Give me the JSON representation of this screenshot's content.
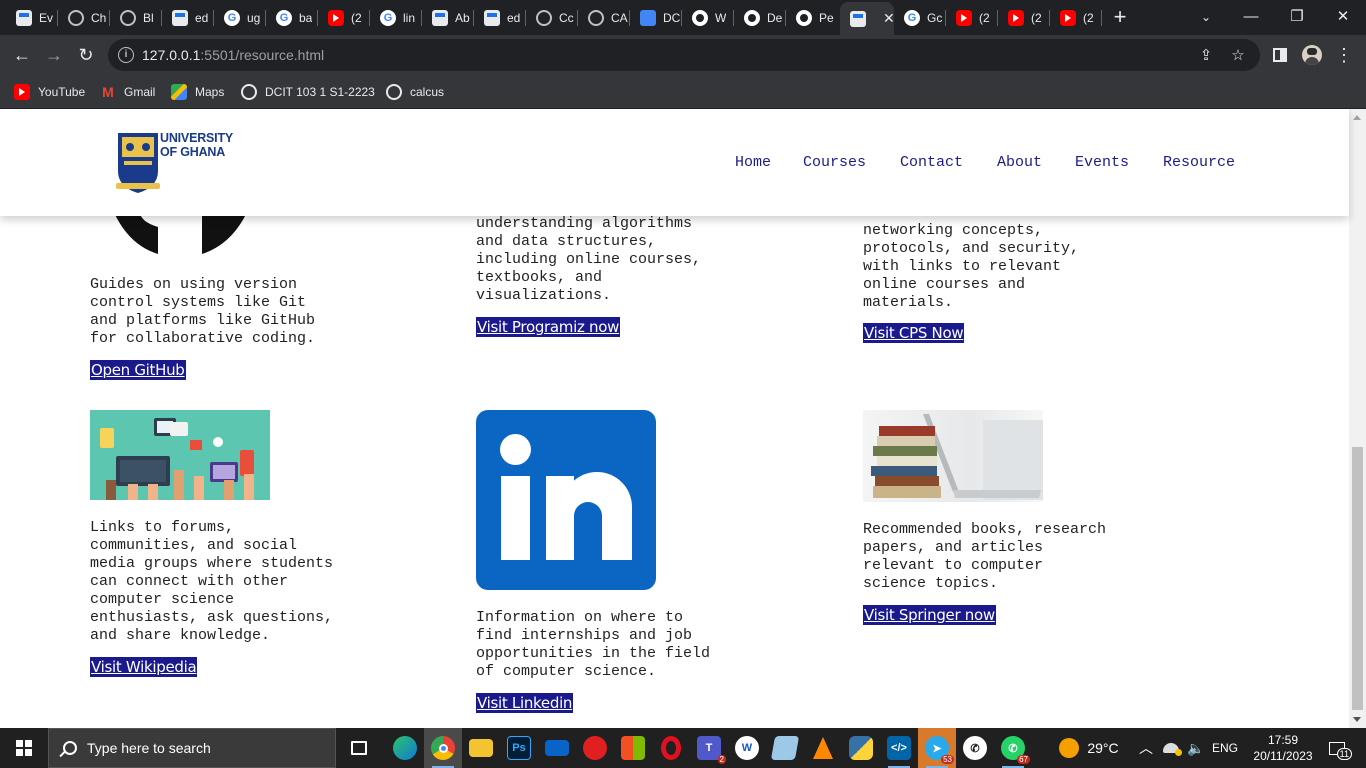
{
  "browser": {
    "tabs": [
      {
        "title": "Ev",
        "icon": "doc"
      },
      {
        "title": "Ch",
        "icon": "chatgpt"
      },
      {
        "title": "Bl",
        "icon": "globe"
      },
      {
        "title": "ed",
        "icon": "doc"
      },
      {
        "title": "ug",
        "icon": "google"
      },
      {
        "title": "ba",
        "icon": "google"
      },
      {
        "title": "(2",
        "icon": "youtube"
      },
      {
        "title": "lin",
        "icon": "google"
      },
      {
        "title": "Ab",
        "icon": "doc"
      },
      {
        "title": "ed",
        "icon": "doc"
      },
      {
        "title": "Cc",
        "icon": "globe"
      },
      {
        "title": "CA",
        "icon": "globe"
      },
      {
        "title": "DC",
        "icon": "gdoc"
      },
      {
        "title": "W",
        "icon": "github"
      },
      {
        "title": "De",
        "icon": "github"
      },
      {
        "title": "Pe",
        "icon": "github"
      },
      {
        "title": "",
        "icon": "doc",
        "active": true
      },
      {
        "title": "Gc",
        "icon": "google"
      },
      {
        "title": "(2",
        "icon": "youtube"
      },
      {
        "title": "(2",
        "icon": "youtube"
      },
      {
        "title": "(2",
        "icon": "youtube"
      }
    ],
    "new_tab_symbol": "+",
    "close_symbol": "✕",
    "url_host": "127.0.0.1",
    "url_rest": ":5501/resource.html",
    "bookmarks": [
      {
        "label": "YouTube",
        "icon": "youtube"
      },
      {
        "label": "Gmail",
        "icon": "gmail"
      },
      {
        "label": "Maps",
        "icon": "maps"
      },
      {
        "label": "DCIT 103 1 S1-2223",
        "icon": "globe"
      },
      {
        "label": "calcus",
        "icon": "globe"
      }
    ]
  },
  "site": {
    "logo_line1": "UNIVERSITY",
    "logo_line2": "OF GHANA",
    "nav": [
      "Home",
      "Courses",
      "Contact",
      "About",
      "Events",
      "Resource"
    ]
  },
  "cards": [
    {
      "text": "Guides on using version\ncontrol systems like Git\nand platforms like GitHub\nfor collaborative coding.",
      "button": "Open GitHub"
    },
    {
      "text": "understanding algorithms\nand data structures,\nincluding online courses,\ntextbooks, and\nvisualizations.",
      "button": "Visit Programiz now"
    },
    {
      "text": "Contains information on\nnetworking concepts,\nprotocols, and security,\nwith links to relevant\nonline courses and\nmaterials.",
      "button": "Visit CPS Now"
    },
    {
      "text": "Links to forums,\ncommunities, and social\nmedia groups where students\ncan connect with other\ncomputer science\nenthusiasts, ask questions,\nand share knowledge.",
      "button": "Visit Wikipedia"
    },
    {
      "text": "Information on where to\nfind internships and job\nopportunities in the field\nof computer science.",
      "button": "Visit Linkedin"
    },
    {
      "text": "Recommended books, research\npapers, and articles\nrelevant to computer\nscience topics.",
      "button": "Visit Springer now"
    }
  ],
  "linkedin_logo_text": "in",
  "taskbar": {
    "search_placeholder": "Type here to search",
    "weather": "29°C",
    "lang": "ENG",
    "time": "17:59",
    "date": "20/11/2023",
    "notifications": "11",
    "badges": {
      "teams": "2",
      "telegram": "53",
      "whatsapp": "67"
    }
  },
  "colors": {
    "button_bg": "#1a1a8c",
    "nav_link": "#1c1c8c",
    "linkedin_blue": "#0a66c2"
  }
}
